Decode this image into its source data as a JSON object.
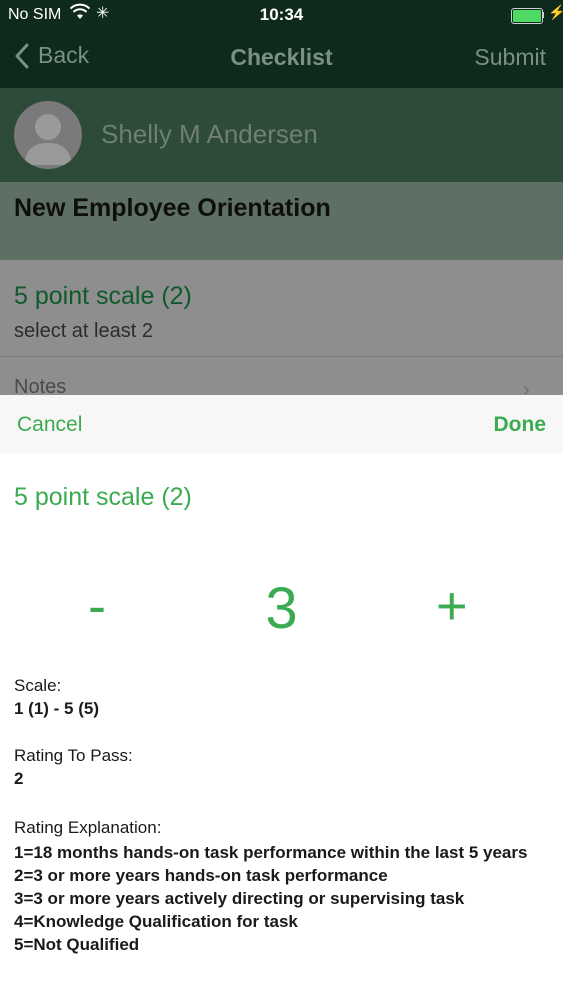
{
  "status_bar": {
    "carrier": "No SIM",
    "time": "10:34"
  },
  "nav": {
    "back_label": "Back",
    "title": "Checklist",
    "submit_label": "Submit"
  },
  "profile": {
    "name": "Shelly M Andersen"
  },
  "checklist": {
    "title": "New Employee Orientation"
  },
  "item": {
    "name": "5 point scale (2)",
    "hint": "select at least 2",
    "notes_label": "Notes"
  },
  "picker": {
    "cancel_label": "Cancel",
    "done_label": "Done",
    "item_name": "5 point scale (2)",
    "minus_label": "-",
    "value": "3",
    "plus_label": "+",
    "scale_label": "Scale:",
    "scale_value": "1 (1) - 5 (5)",
    "pass_label": "Rating To Pass:",
    "pass_value": "2",
    "explanation_label": "Rating Explanation:",
    "explanation_lines": [
      "1=18 months hands-on task performance within the last 5 years",
      "2=3 or more years hands-on task performance",
      "3=3 or more years actively directing or supervising task",
      "4=Knowledge Qualification for task",
      "5=Not Qualified"
    ]
  },
  "colors": {
    "accent_green": "#3bab52",
    "nav_dark": "#0e2a1c",
    "battery_green": "#4cd964"
  },
  "icons": [
    "wifi-icon",
    "activity-spinner-icon",
    "battery-icon",
    "charging-bolt-icon",
    "back-chevron-icon",
    "avatar-placeholder-icon",
    "disclosure-chevron-icon"
  ]
}
